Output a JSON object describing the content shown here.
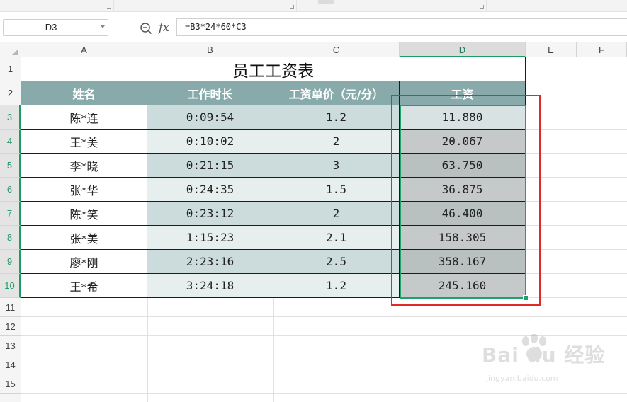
{
  "formula_bar": {
    "name_box": "D3",
    "fx_label": "fx",
    "formula": "=B3*24*60*C3"
  },
  "columns": [
    "A",
    "B",
    "C",
    "D",
    "E",
    "F"
  ],
  "selected_column": "D",
  "rows": [
    "1",
    "2",
    "3",
    "4",
    "5",
    "6",
    "7",
    "8",
    "9",
    "10",
    "11",
    "12",
    "13",
    "14",
    "15"
  ],
  "selected_rows": [
    "3",
    "4",
    "5",
    "6",
    "7",
    "8",
    "9",
    "10"
  ],
  "sheet": {
    "title": "员工工资表",
    "headers": [
      "姓名",
      "工作时长",
      "工资单价（元/分）",
      "工资"
    ],
    "data": [
      [
        "陈*连",
        "0:09:54",
        "1.2",
        "11.880"
      ],
      [
        "王*美",
        "0:10:02",
        "2",
        "20.067"
      ],
      [
        "李*晓",
        "0:21:15",
        "3",
        "63.750"
      ],
      [
        "张*华",
        "0:24:35",
        "1.5",
        "36.875"
      ],
      [
        "陈*笑",
        "0:23:12",
        "2",
        "46.400"
      ],
      [
        "张*美",
        "1:15:23",
        "2.1",
        "158.305"
      ],
      [
        "廖*刚",
        "2:23:16",
        "2.5",
        "358.167"
      ],
      [
        "王*希",
        "3:24:18",
        "1.2",
        "245.160"
      ]
    ]
  },
  "colors": {
    "header_fill": "#88aaaa",
    "band_light": "#e7eeee",
    "band_dark": "#ccdbdb",
    "selection": "#1fa16a",
    "annotation": "#e02a2a"
  },
  "watermark": {
    "main": "Bai du 经验",
    "sub": "jingyan.baidu.com"
  }
}
